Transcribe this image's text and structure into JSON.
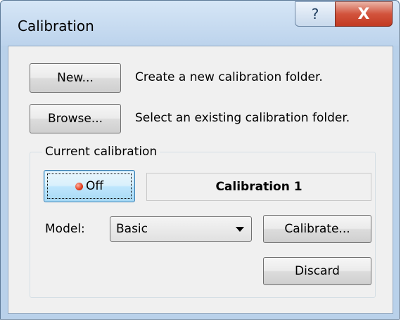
{
  "window": {
    "title": "Calibration",
    "help_glyph": "?",
    "close_glyph": "X"
  },
  "actions": {
    "new_label": "New...",
    "new_description": "Create a new calibration folder.",
    "browse_label": "Browse...",
    "browse_description": "Select an existing calibration folder."
  },
  "current": {
    "group_label": "Current calibration",
    "toggle_label": "Off",
    "toggle_led_color": "#e03c1e",
    "calibration_name": "Calibration 1",
    "model_label": "Model:",
    "model_value": "Basic",
    "calibrate_label": "Calibrate...",
    "discard_label": "Discard"
  }
}
